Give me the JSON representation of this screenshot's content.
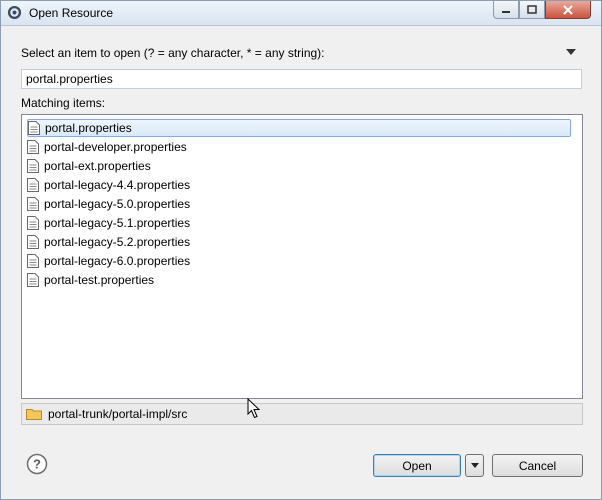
{
  "window": {
    "title": "Open Resource",
    "title_icon": "eclipse-gear-icon"
  },
  "prompt": {
    "label": "Select an item to open (? = any character, * = any string):"
  },
  "filter": {
    "value": "portal.properties"
  },
  "matching": {
    "label": "Matching items:",
    "items": [
      {
        "label": "portal.properties",
        "selected": true
      },
      {
        "label": "portal-developer.properties",
        "selected": false
      },
      {
        "label": "portal-ext.properties",
        "selected": false
      },
      {
        "label": "portal-legacy-4.4.properties",
        "selected": false
      },
      {
        "label": "portal-legacy-5.0.properties",
        "selected": false
      },
      {
        "label": "portal-legacy-5.1.properties",
        "selected": false
      },
      {
        "label": "portal-legacy-5.2.properties",
        "selected": false
      },
      {
        "label": "portal-legacy-6.0.properties",
        "selected": false
      },
      {
        "label": "portal-test.properties",
        "selected": false
      }
    ]
  },
  "status": {
    "path": "portal-trunk/portal-impl/src",
    "icon": "folder-icon"
  },
  "buttons": {
    "open": "Open",
    "cancel": "Cancel"
  },
  "colors": {
    "selection_border": "#84acdd",
    "close_button": "#c8553f"
  }
}
